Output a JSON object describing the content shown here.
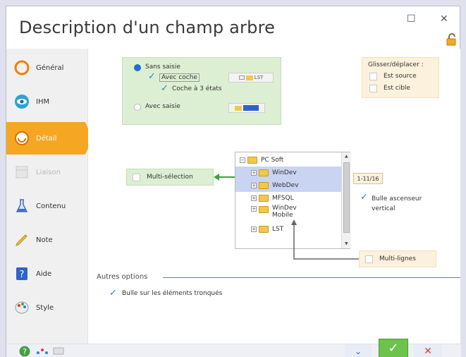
{
  "window": {
    "title": "Description d'un champ arbre",
    "maximize_glyph": "☐",
    "close_glyph": "✕"
  },
  "sidebar": {
    "items": [
      {
        "label": "Général",
        "icon": "general-icon"
      },
      {
        "label": "IHM",
        "icon": "eye-icon"
      },
      {
        "label": "Détail",
        "icon": "detail-icon"
      },
      {
        "label": "Liaison",
        "icon": "link-icon"
      },
      {
        "label": "Contenu",
        "icon": "flask-icon"
      },
      {
        "label": "Note",
        "icon": "pencil-icon"
      },
      {
        "label": "Aide",
        "icon": "help-icon"
      },
      {
        "label": "Style",
        "icon": "palette-icon"
      }
    ]
  },
  "input_mode": {
    "sans_saisie": "Sans saisie",
    "avec_coche": "Avec coche",
    "coche_3_etats": "Coche à 3 états",
    "avec_saisie": "Avec saisie",
    "preview_label": "LST"
  },
  "drag_drop": {
    "title": "Glisser/déplacer :",
    "source": "Est source",
    "target": "Est cible"
  },
  "tree": {
    "root": "PC Soft",
    "items": [
      "WinDev",
      "WebDev",
      "MFSQL",
      "WinDev Mobile",
      "LST"
    ]
  },
  "counter": "1-11/16",
  "options": {
    "multi_selection": "Multi-sélection",
    "bulle_ascenseur": "Bulle ascenseur vertical",
    "multi_lignes": "Multi-lignes",
    "autres_options": "Autres options",
    "bulle_tronques": "Bulle sur les éléments tronqués"
  },
  "colors": {
    "accent_orange": "#f5a623",
    "green_panel": "#dcefd3",
    "beige_panel": "#fbf1dc",
    "selection_blue": "#c9d4f3",
    "check_blue": "#2d7bd6"
  }
}
